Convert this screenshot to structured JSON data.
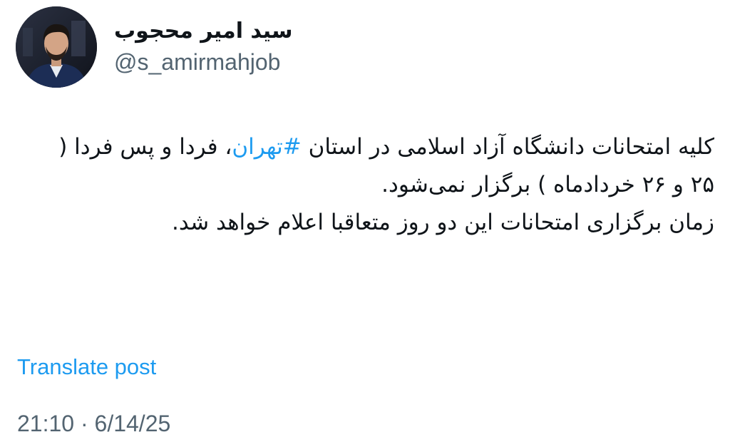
{
  "author": {
    "display_name": "سید امیر محجوب",
    "handle": "@s_amirmahjob",
    "avatar_icon": "person-avatar"
  },
  "post": {
    "text_part1": "کلیه امتحانات دانشگاه آزاد اسلامی در استان ",
    "hashtag": "#تهران",
    "text_part2": "، فردا و پس فردا ( ۲۵ و ۲۶ خردادماه ) برگزار نمی‌شود.",
    "text_part3": "زمان برگزاری امتحانات این دو روز متعاقبا اعلام خواهد شد."
  },
  "actions": {
    "translate_label": "Translate post"
  },
  "meta": {
    "timestamp": "21:10 · 6/14/25"
  },
  "colors": {
    "link": "#1d9bf0",
    "text": "#0f1419",
    "secondary": "#536471"
  }
}
